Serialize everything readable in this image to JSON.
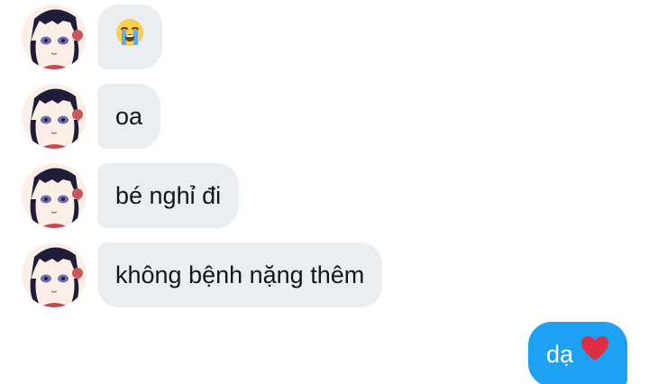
{
  "messages": [
    {
      "sender": "other",
      "text": "",
      "emoji": "loudly-crying-face-emoji"
    },
    {
      "sender": "other",
      "text": "oa"
    },
    {
      "sender": "other",
      "text": "bé nghỉ đi"
    },
    {
      "sender": "other",
      "text": "không bệnh nặng thêm"
    },
    {
      "sender": "me",
      "text": "dạ",
      "emoji": "red-heart-emoji"
    }
  ],
  "colors": {
    "incoming_bubble": "#ebeef1",
    "outgoing_bubble": "#1da1f2",
    "text_dark": "#14171a",
    "text_light": "#ffffff"
  }
}
